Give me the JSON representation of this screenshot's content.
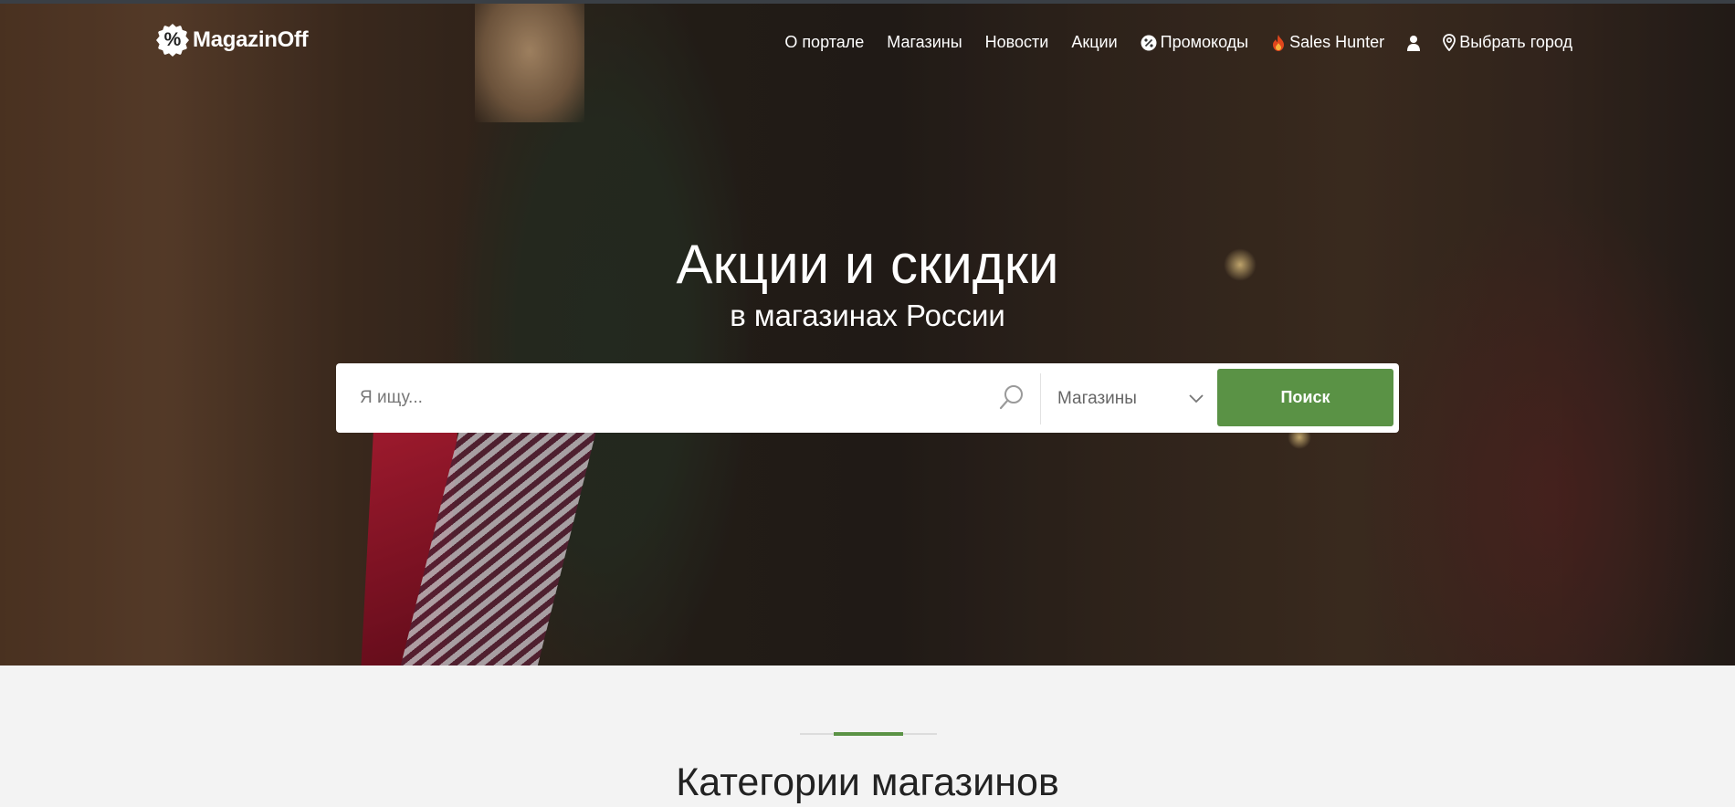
{
  "header": {
    "logo_glyph": "%",
    "logo_text": "MagazinOff",
    "nav": {
      "about": "О портале",
      "shops": "Магазины",
      "news": "Новости",
      "sales": "Акции",
      "promocodes": "Промокоды",
      "sales_hunter": "Sales Hunter",
      "city": "Выбрать город"
    },
    "icons": {
      "promocodes": "percent-badge-icon",
      "sales_hunter": "flame-icon",
      "account": "user-icon",
      "city": "map-pin-icon"
    }
  },
  "hero": {
    "title": "Акции и скидки",
    "subtitle": "в магазинах России"
  },
  "search": {
    "placeholder": "Я ищу...",
    "category_selected": "Магазины",
    "button_label": "Поиск",
    "icons": {
      "search": "search-icon",
      "dropdown": "chevron-down-icon"
    }
  },
  "section": {
    "title": "Категории магазинов"
  },
  "colors": {
    "accent": "#5a9245",
    "flame": "#e0461c"
  }
}
